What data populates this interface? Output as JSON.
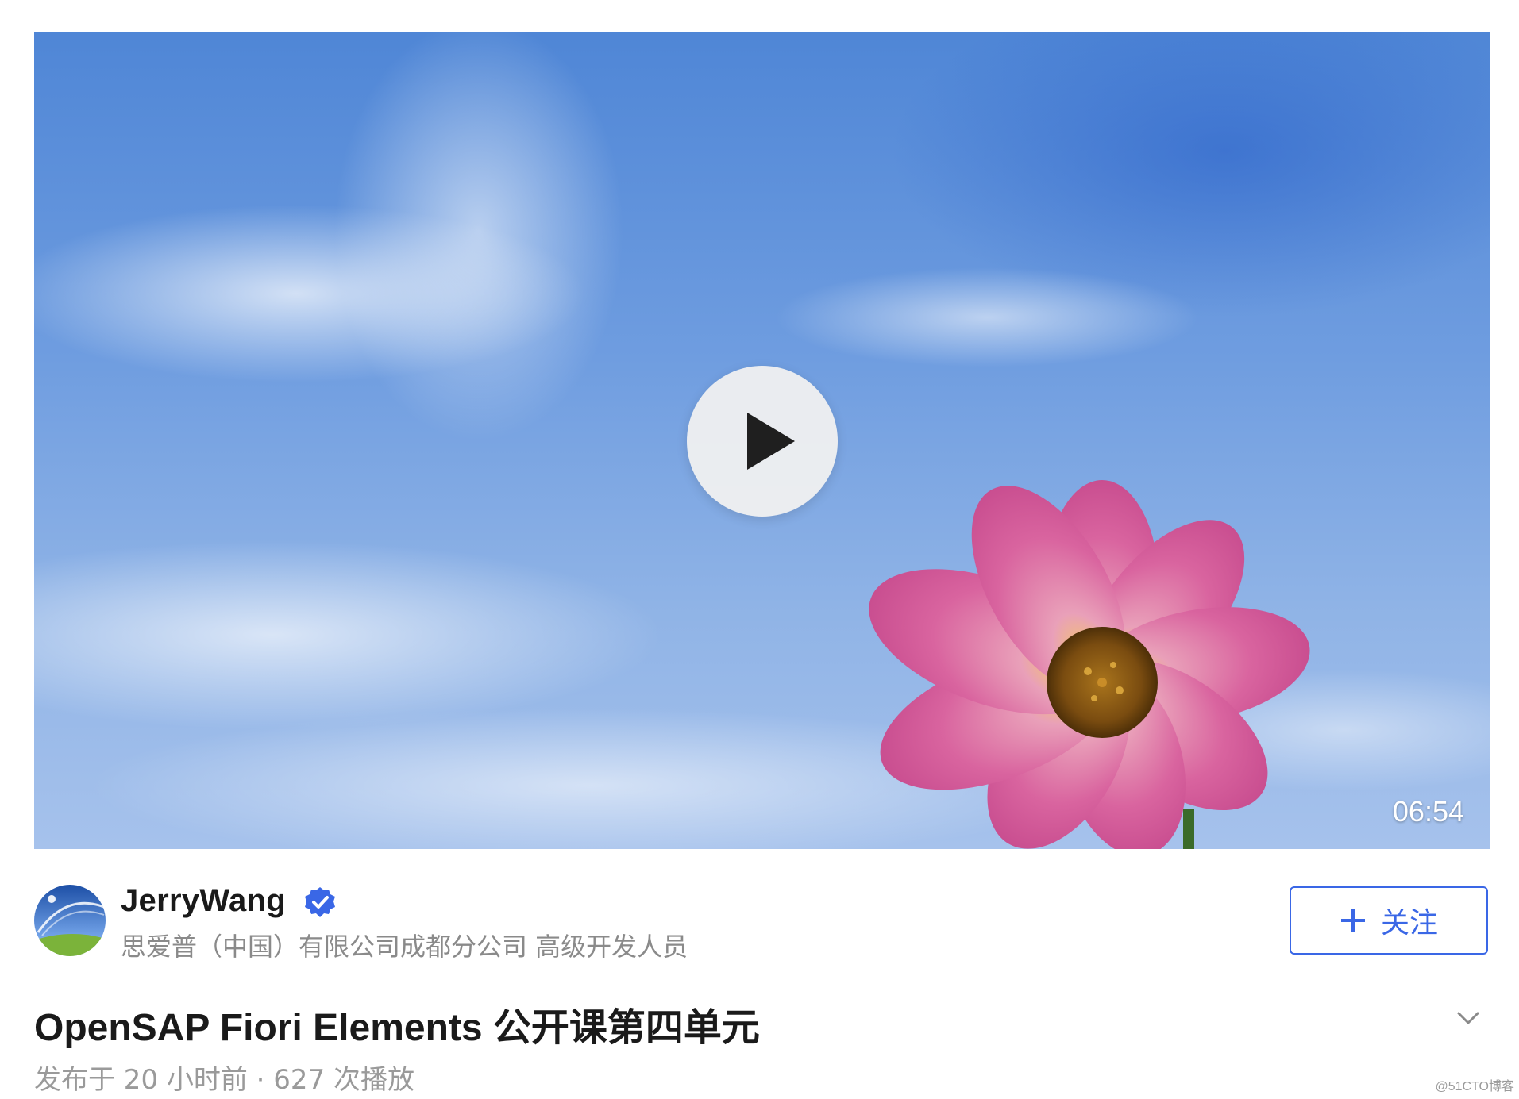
{
  "video": {
    "duration": "06:54",
    "play_icon": "play-icon"
  },
  "author": {
    "name": "JerryWang",
    "title": "思爱普（中国）有限公司成都分公司 高级开发人员",
    "verified_icon": "verified-badge-icon",
    "avatar_icon": "avatar"
  },
  "follow": {
    "label": "关注",
    "icon": "plus-icon"
  },
  "post": {
    "title": "OpenSAP Fiori Elements 公开课第四单元",
    "meta": "发布于 20 小时前 · 627 次播放",
    "expand_icon": "chevron-down-icon"
  },
  "watermark": "@51CTO博客",
  "colors": {
    "accent": "#3a67e6",
    "text_primary": "#1a1a1a",
    "text_secondary": "#8a8a8a"
  }
}
